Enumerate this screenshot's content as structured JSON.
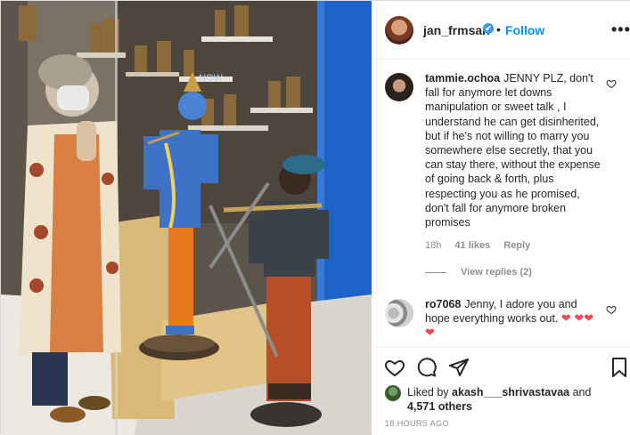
{
  "post": {
    "owner_username": "jan_frmsan",
    "verified_badge": "✔",
    "separator": "•",
    "follow_label": "Follow",
    "more_label": "•••",
    "shop_sign": "NOW",
    "photo_icon": "photo-of-woman-with-blue-krishna-and-flute-player-statues"
  },
  "comments": [
    {
      "username": "tammie.ochoa",
      "text": "JENNY PLZ, don't fall for anymore let downs manipulation or sweet talk , I understand he can get disinherited, but if he's not willing to marry you somewhere else secretly, that you can stay there, without the expense of going back & forth, plus respecting you as he promised, don't fall for anymore broken promises",
      "age": "18h",
      "likes": "41 likes",
      "reply_label": "Reply",
      "view_replies": "View replies (2)"
    },
    {
      "username": "ro7068",
      "text": "Jenny, I adore you and hope everything works out.",
      "hearts": "❤ ❤❤❤"
    }
  ],
  "actions": {
    "liked_by_prefix": "Liked by",
    "liked_by_user": "akash___shrivastavaa",
    "liked_by_and": "and",
    "others_count": "4,571 others",
    "timestamp": "18 HOURS AGO"
  },
  "colors": {
    "link_blue": "#0095f6",
    "heart_red": "#ed4956",
    "muted_gray": "#8e8e8e",
    "wall_blue": "#1e63c7"
  },
  "icons": [
    "verified-badge-icon",
    "heart-icon",
    "comment-icon",
    "share-icon",
    "bookmark-icon",
    "more-options-icon"
  ]
}
